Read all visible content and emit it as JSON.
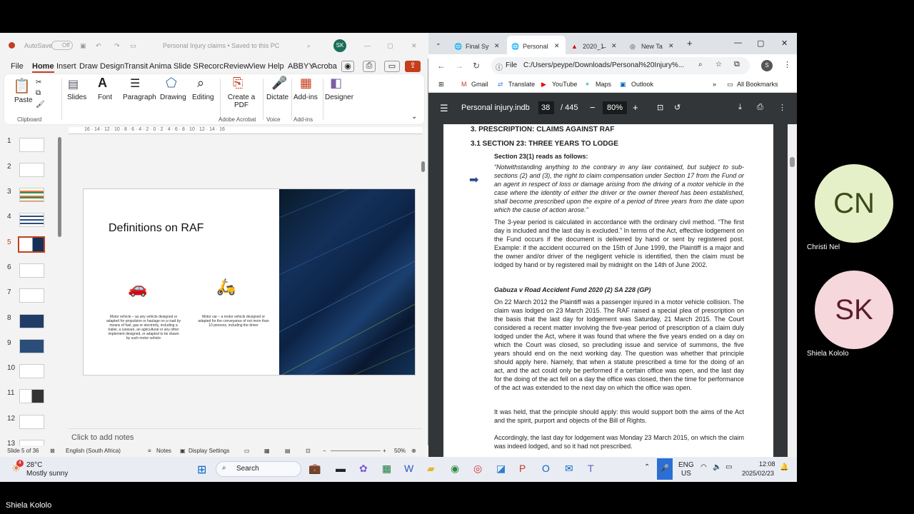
{
  "ppt": {
    "title_bar": {
      "autosave": "AutoSave",
      "toggle": "Off",
      "doc_title": "Personal Injury claims • Saved to this PC",
      "avatar": "SK"
    },
    "menu": [
      "File",
      "Home",
      "Insert",
      "Draw",
      "Design",
      "Transit",
      "Anima",
      "Slide S",
      "Recorc",
      "Review",
      "View",
      "Help",
      "ABBYY",
      "Acroba"
    ],
    "ribbon": {
      "paste": "Paste",
      "clipboard": "Clipboard",
      "slides": "Slides",
      "font": "Font",
      "paragraph": "Paragraph",
      "drawing": "Drawing",
      "editing": "Editing",
      "create_pdf": "Create a PDF",
      "adobe_acrobat": "Adobe Acrobat",
      "dictate": "Dictate",
      "voice": "Voice",
      "addins": "Add-ins",
      "addins_group": "Add-ins",
      "designer": "Designer"
    },
    "ruler": "16 · 14 · 12 · 10 · 8 · 6 · 4 · 2 · 0 · 2 · 4 · 6 · 8 · 10 · 12 · 14 · 16",
    "thumb_numbers": [
      "1",
      "2",
      "3",
      "4",
      "5",
      "6",
      "7",
      "8",
      "9",
      "10",
      "11",
      "12",
      "13"
    ],
    "slide": {
      "title": "Definitions on RAF",
      "left_text": "Motor vehicle – as any vehicle designed or adapted for propulsion or haulage on a road by means of fuel, gas or electricity, including a trailer, a caravan, an agricultural or any other implement designed, or adapted to be drawn by such motor vehicle",
      "right_text": "Motor car – a motor vehicle designed or adapted for the conveyance of not more than 10 persons, including the driver"
    },
    "notes": "Click to add notes",
    "status": {
      "slide": "Slide 5 of 36",
      "language": "English (South Africa)",
      "notes": "Notes",
      "display": "Display Settings",
      "zoom": "50%"
    }
  },
  "chrome": {
    "tabs": [
      "Final Sy",
      "Personal",
      "2020_1̶",
      "New Ta"
    ],
    "url": "C:/Users/peype/Downloads/Personal%20Injury%...",
    "file_label": "File",
    "profile": "S",
    "bookmarks": [
      "Gmail",
      "Translate",
      "YouTube",
      "Maps",
      "Outlook"
    ],
    "all_bookmarks": "All Bookmarks",
    "pdf": {
      "name": "Personal injury.indb",
      "page": "38",
      "total": "/ 445",
      "zoom": "80%"
    },
    "doc": {
      "h1": "3.    PRESCRIPTION: CLAIMS AGAINST RAF",
      "h2": "3.1      SECTION 23: THREE YEARS TO LODGE",
      "h3": "Section 23(1) reads as follows:",
      "quote": "“Notwithstanding anything to the contrary in any law contained, but subject to sub-sections (2) and (3), the right to claim compensation under Section 17 from the Fund or an agent in respect of loss or damage arising from the driving of a motor vehicle in the case where the identity of either the driver or the owner thereof has been established, shall become prescribed upon the expire of a period of three years from the date upon which the cause of action arose.”",
      "para1": "The 3-year period is calculated in accordance with the ordinary civil method. “The first day is included and the last day is excluded.” In terms of the Act, effective lodgement on the Fund occurs if the document is delivered by hand or sent by registered post. Example: if the accident occurred on the 15th of June 1999, the Plaintiff is a major and the owner and/or driver of the negligent vehicle is identified, then the claim must be lodged by hand or by registered mail by midnight on the 14th of June 2002.",
      "case": "Gabuza v Road Accident Fund 2020 (2) SA 228 (GP)",
      "para2": "On 22 March 2012 the Plaintiff was a passenger injured in a motor vehicle collision. The claim was lodged on 23 March 2015. The RAF raised a special plea of prescription on the basis that the last day for lodgement was Saturday, 21 March 2015. The Court considered a recent matter involving the five-year period of prescription of a claim duly lodged under the Act, where it was found that where the five years ended on a day on which the Court was closed, so precluding issue and service of summons, the five years should end on the next working day. The question was whether that principle should apply here. Namely, that when a statute prescribed a time for the doing of an act, and the act could only be performed if a certain office was open, and the last day for the doing of the act fell on a day the office was closed, then the time for performance of the act was extended to the next day on which the office was open.",
      "para3": "It was held, that the principle should apply: this would support both the aims of the Act and the spirit, purport and objects of the Bill of Rights.",
      "para4": "Accordingly, the last day for lodgement was Monday 23 March 2015, on which the claim was indeed lodged, and so it had not prescribed."
    }
  },
  "taskbar": {
    "temp": "28°C",
    "weather": "Mostly sunny",
    "badge": "4",
    "search": "Search",
    "lang": "ENG",
    "region": "US",
    "time": "12:08",
    "date": "2025/02/23"
  },
  "participants": [
    {
      "initials": "CN",
      "name": "Christi Nel",
      "color": "#e6f0c8",
      "text_color": "#3c4a18"
    },
    {
      "initials": "SK",
      "name": "Shiela Kololo",
      "color": "#f5d7dc",
      "text_color": "#5a1e26"
    }
  ],
  "speaker": "Shiela Kololo"
}
